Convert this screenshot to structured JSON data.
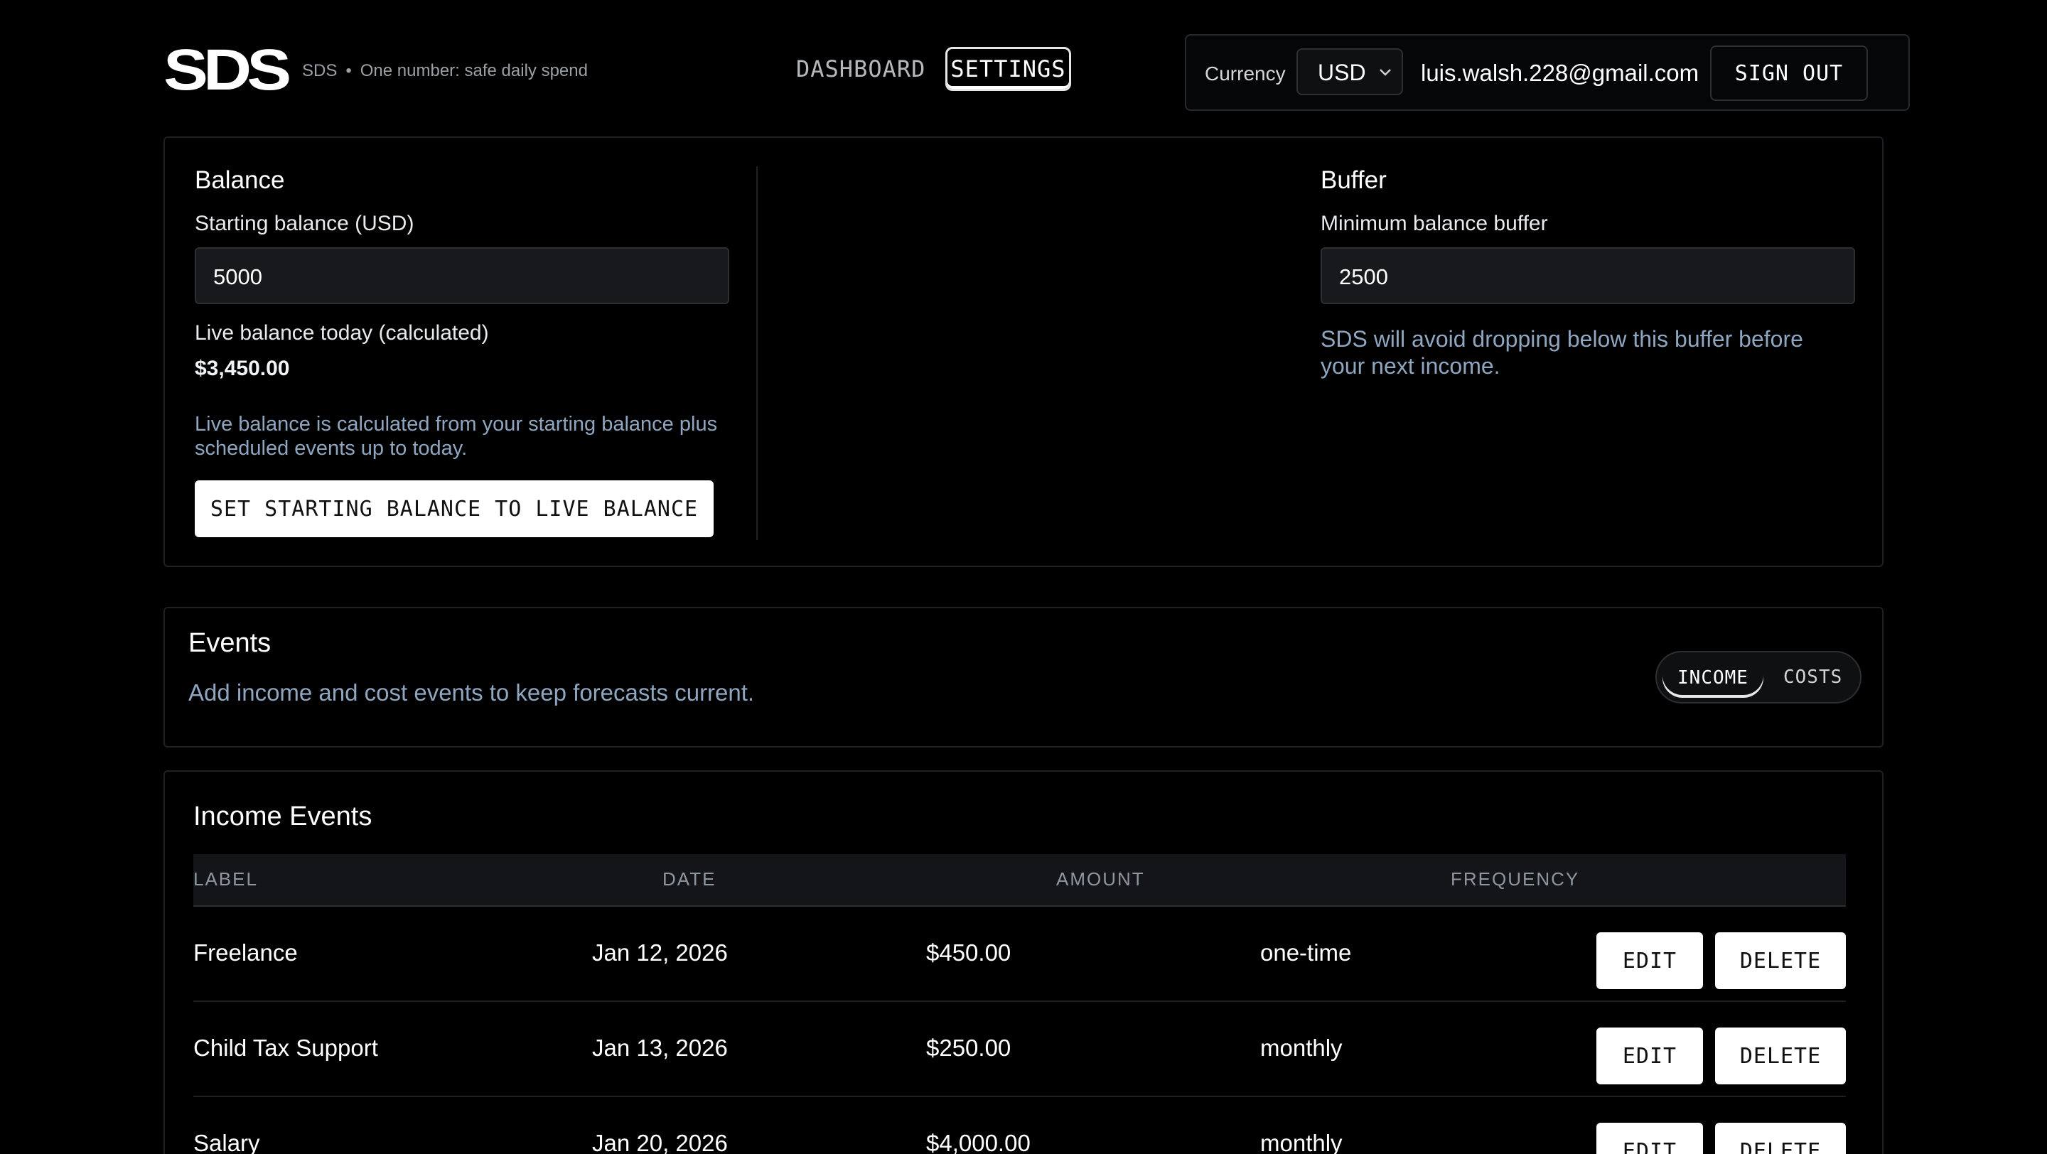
{
  "header": {
    "logo": "SDS",
    "brand": "SDS",
    "separator": "•",
    "tagline": "One number: safe daily spend",
    "nav": [
      {
        "label": "DASHBOARD",
        "active": false
      },
      {
        "label": "SETTINGS",
        "active": true
      }
    ],
    "currency_label": "Currency",
    "currency_value": "USD",
    "email": "luis.walsh.228@gmail.com",
    "signout_label": "SIGN OUT"
  },
  "balance": {
    "title": "Balance",
    "starting_label": "Starting balance (USD)",
    "starting_value": "5000",
    "live_label": "Live balance today (calculated)",
    "live_value": "$3,450.00",
    "live_note": "Live balance is calculated from your starting balance plus scheduled events up to today.",
    "set_button": "SET STARTING BALANCE TO LIVE BALANCE"
  },
  "buffer": {
    "title": "Buffer",
    "min_label": "Minimum balance buffer",
    "min_value": "2500",
    "note": "SDS will avoid dropping below this buffer before your next income."
  },
  "events": {
    "title": "Events",
    "subtitle": "Add income and cost events to keep forecasts current.",
    "toggle": {
      "income": "INCOME",
      "costs": "COSTS",
      "selected": "INCOME"
    }
  },
  "income": {
    "title": "Income Events",
    "columns": [
      "LABEL",
      "DATE",
      "AMOUNT",
      "FREQUENCY"
    ],
    "rows": [
      {
        "label": "Freelance",
        "date": "Jan 12, 2026",
        "amount": "$450.00",
        "frequency": "one-time"
      },
      {
        "label": "Child Tax Support",
        "date": "Jan 13, 2026",
        "amount": "$250.00",
        "frequency": "monthly"
      },
      {
        "label": "Salary",
        "date": "Jan 20, 2026",
        "amount": "$4,000.00",
        "frequency": "monthly"
      }
    ],
    "edit_label": "EDIT",
    "delete_label": "DELETE"
  },
  "colors": {
    "background": "#000000",
    "muted_text": "#8fa6c0",
    "border": "#2c2f33",
    "button_bg": "#ffffff"
  }
}
